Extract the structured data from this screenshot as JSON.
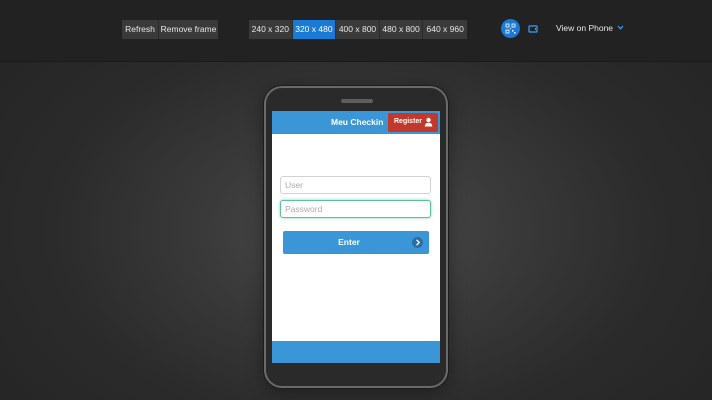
{
  "toolbar": {
    "refresh_label": "Refresh",
    "remove_frame_label": "Remove frame",
    "sizes": [
      "240 x 320",
      "320 x 480",
      "400 x 800",
      "480 x 800",
      "640 x 960"
    ],
    "active_size": "320 x 480",
    "view_on_phone_label": "View on Phone",
    "accent_color": "#1a7bd6",
    "icons": [
      "qr-code-icon",
      "rotate-orientation-icon",
      "chevron-down-icon"
    ]
  },
  "app": {
    "title": "Meu Checkin",
    "register_label": "Register",
    "user_placeholder": "User",
    "password_placeholder": "Password",
    "enter_label": "Enter",
    "header_color": "#3a96d6",
    "register_color": "#c0392b",
    "icons": [
      "user-icon",
      "arrow-right-icon"
    ]
  }
}
